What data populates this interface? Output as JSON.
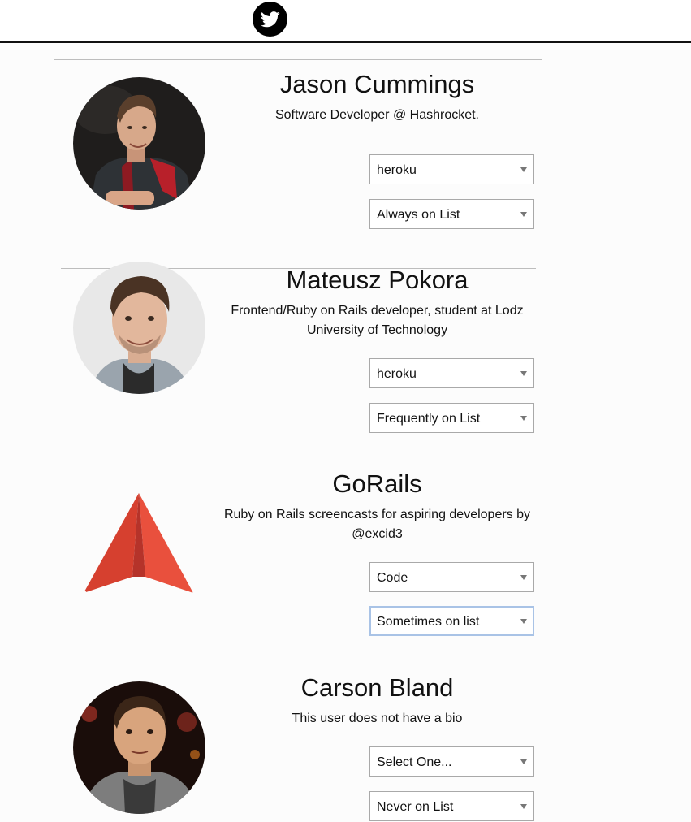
{
  "header": {
    "twitter_icon": "twitter-bird-icon"
  },
  "colors": {
    "page_bg": "#fcfcfc",
    "divider": "#bdbdbd",
    "focus_border": "#a9c3e6",
    "twitter_circle": "#000000"
  },
  "users": [
    {
      "name": "Jason Cummings",
      "bio": "Software Developer @ Hashrocket.",
      "category": "heroku",
      "frequency": "Always on List",
      "avatar": "photo"
    },
    {
      "name": "Mateusz Pokora",
      "bio": "Frontend/Ruby on Rails developer, student at Lodz University of Technology",
      "category": "heroku",
      "frequency": "Frequently on List",
      "avatar": "photo"
    },
    {
      "name": "GoRails",
      "bio": "Ruby on Rails screencasts for aspiring developers by @excid3",
      "category": "Code",
      "frequency": "Sometimes on list",
      "avatar": "logo"
    },
    {
      "name": "Carson Bland",
      "bio": "This user does not have a bio",
      "category": "Select One...",
      "frequency": "Never on List",
      "avatar": "photo"
    }
  ]
}
